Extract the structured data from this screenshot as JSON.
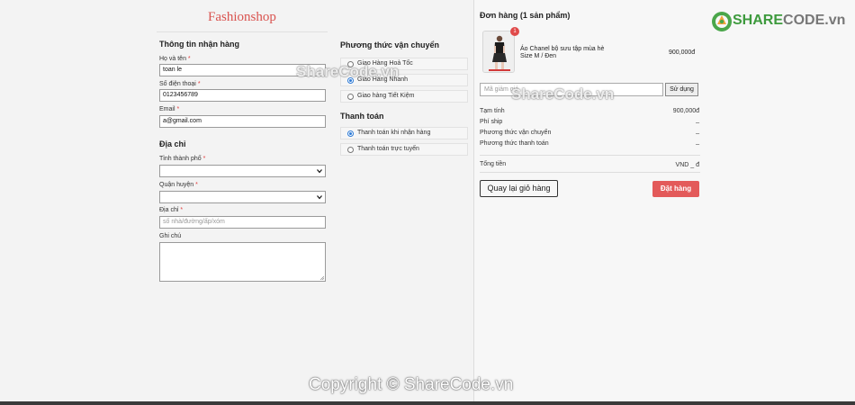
{
  "shop": {
    "title": "Fashionshop"
  },
  "shipping_info": {
    "heading": "Thông tin nhận hàng",
    "name_label": "Họ và tên",
    "name_value": "toan le",
    "phone_label": "Số điện thoại",
    "phone_value": "0123456789",
    "email_label": "Email",
    "email_value": "a@gmail.com",
    "required_mark": "*"
  },
  "address": {
    "heading": "Địa chỉ",
    "city_label": "Tỉnh thành phố",
    "district_label": "Quận huyện",
    "street_label": "Địa chỉ",
    "street_placeholder": "số nhà/đường/ấp/xóm",
    "note_label": "Ghi chú"
  },
  "shipping_method": {
    "heading": "Phương thức vận chuyển",
    "options": [
      "Giao Hàng Hoả Tốc",
      "Giao Hàng Nhanh",
      "Giao hàng Tiết Kiệm"
    ],
    "selected_index": 1
  },
  "payment": {
    "heading": "Thanh toán",
    "options": [
      "Thanh toán khi nhận hàng",
      "Thanh toán trực tuyến"
    ],
    "selected_index": 0
  },
  "order": {
    "heading": "Đơn hàng (1 sản phẩm)",
    "item": {
      "name": "Áo Chanel bộ sưu tập mùa hè",
      "variant": "Size M / Đen",
      "price": "900,000đ",
      "qty": "1"
    },
    "coupon_placeholder": "Mã giảm giá",
    "apply_label": "Sử dụng",
    "subtotal_label": "Tạm tính",
    "subtotal_value": "900,000đ",
    "ship_fee_label": "Phí ship",
    "ship_fee_value": "_",
    "ship_method_label": "Phương thức vận chuyển",
    "ship_method_value": "_",
    "pay_method_label": "Phương thức thanh toán",
    "pay_method_value": "_",
    "total_label": "Tổng tiền",
    "total_value": "VND _ đ",
    "back_label": "Quay lại giỏ hàng",
    "submit_label": "Đặt hàng"
  },
  "watermarks": {
    "top": "ShareCode.vn",
    "middle": "ShareCode.vn",
    "bottom": "Copyright © ShareCode.vn",
    "logo_a": "SHARE",
    "logo_b": "CODE.vn"
  },
  "colors": {
    "accent": "#e35a5a",
    "title": "#d9534f",
    "logo_green": "#3d9a3d",
    "radio": "#2e7bd6"
  }
}
